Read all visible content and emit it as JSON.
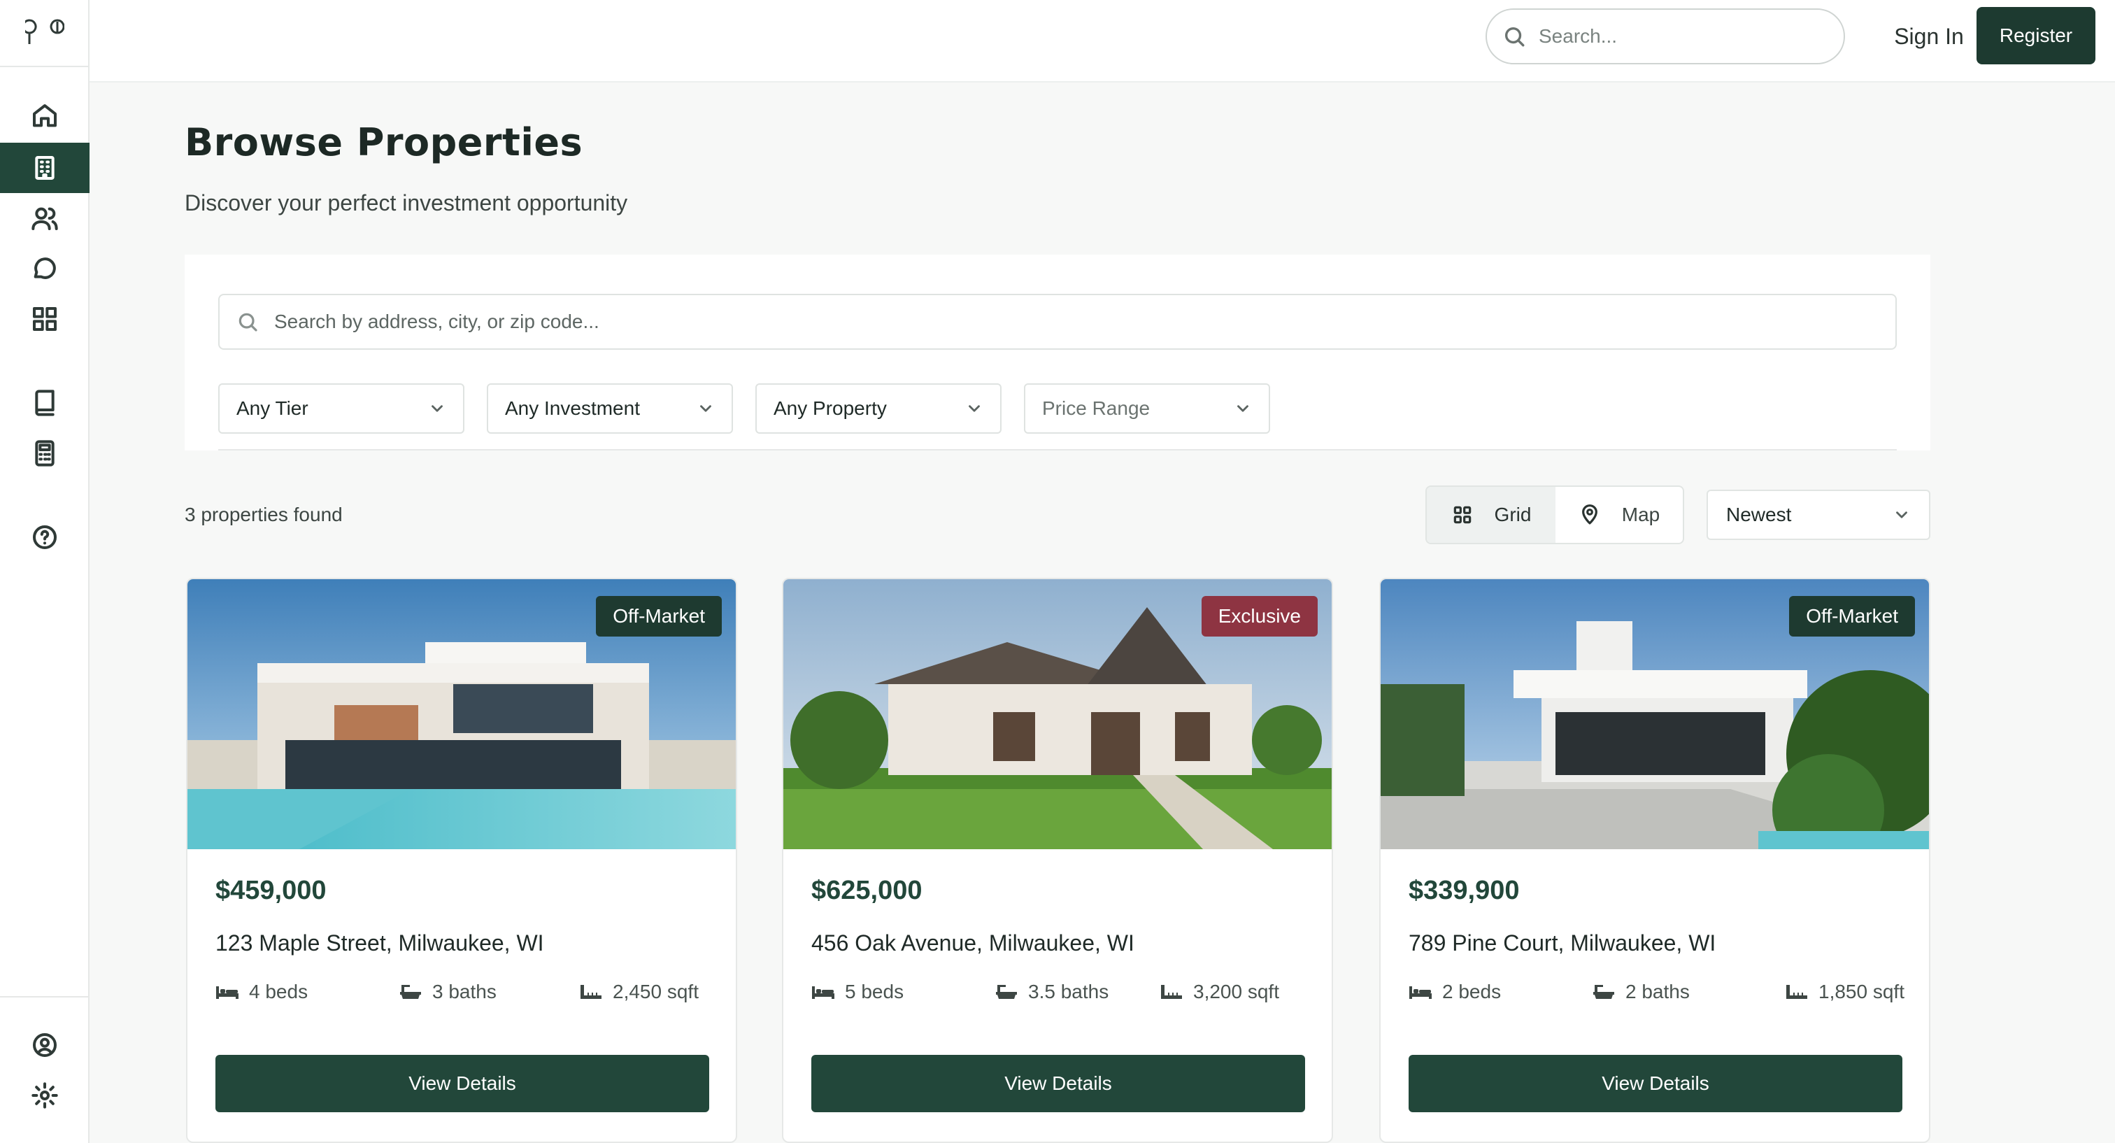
{
  "header": {
    "search_placeholder": "Search...",
    "sign_in": "Sign In",
    "register": "Register"
  },
  "sidebar": {
    "items": [
      {
        "icon": "home-icon",
        "active": false
      },
      {
        "icon": "building-icon",
        "active": true
      },
      {
        "icon": "users-icon",
        "active": false
      },
      {
        "icon": "chat-icon",
        "active": false
      },
      {
        "icon": "grid-icon",
        "active": false
      },
      {
        "icon": "book-icon",
        "active": false
      },
      {
        "icon": "calculator-icon",
        "active": false
      },
      {
        "icon": "help-icon",
        "active": false
      }
    ],
    "bottom": [
      {
        "icon": "account-icon"
      },
      {
        "icon": "settings-icon"
      }
    ]
  },
  "page": {
    "title": "Browse Properties",
    "subtitle": "Discover your perfect investment opportunity"
  },
  "filters": {
    "search_placeholder": "Search by address, city, or zip code...",
    "tier": "Any Tier",
    "investment": "Any Investment",
    "property": "Any Property",
    "price_range": "Price Range"
  },
  "results": {
    "count_text": "3 properties found",
    "view_grid": "Grid",
    "view_map": "Map",
    "active_view": "Grid",
    "sort": "Newest"
  },
  "colors": {
    "brand": "#22473a",
    "badge_dark": "#1e3a30",
    "badge_exclusive": "#8e3442"
  },
  "properties": [
    {
      "badge": "Off-Market",
      "price": "$459,000",
      "address": "123 Maple Street, Milwaukee, WI",
      "beds": "4 beds",
      "baths": "3 baths",
      "sqft": "2,450 sqft",
      "cta": "View Details"
    },
    {
      "badge": "Exclusive",
      "price": "$625,000",
      "address": "456 Oak Avenue, Milwaukee, WI",
      "beds": "5 beds",
      "baths": "3.5 baths",
      "sqft": "3,200 sqft",
      "cta": "View Details"
    },
    {
      "badge": "Off-Market",
      "price": "$339,900",
      "address": "789 Pine Court, Milwaukee, WI",
      "beds": "2 beds",
      "baths": "2 baths",
      "sqft": "1,850 sqft",
      "cta": "View Details"
    }
  ]
}
